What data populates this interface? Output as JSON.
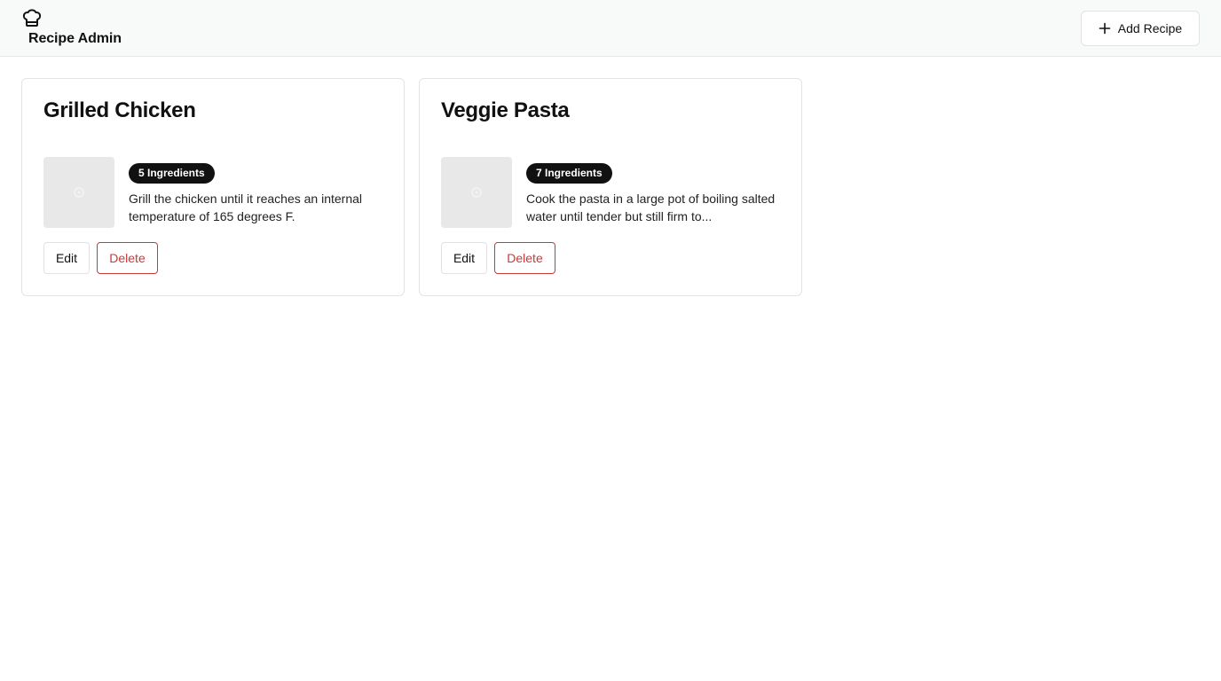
{
  "header": {
    "title": "Recipe Admin",
    "logo_icon": "chef-hat-icon",
    "add_label": "Add Recipe",
    "add_icon": "plus-icon"
  },
  "recipes": [
    {
      "name": "Grilled Chicken",
      "ingredients_badge": "5 Ingredients",
      "description": "Grill the chicken until it reaches an internal temperature of 165 degrees F.",
      "edit_label": "Edit",
      "delete_label": "Delete"
    },
    {
      "name": "Veggie Pasta",
      "ingredients_badge": "7 Ingredients",
      "description": "Cook the pasta in a large pot of boiling salted water until tender but still firm to...",
      "edit_label": "Edit",
      "delete_label": "Delete"
    }
  ],
  "colors": {
    "header_bg": "#f8f9f9",
    "badge_bg": "#111111",
    "danger": "#c9393b",
    "thumb_bg": "#e8e8e8"
  }
}
